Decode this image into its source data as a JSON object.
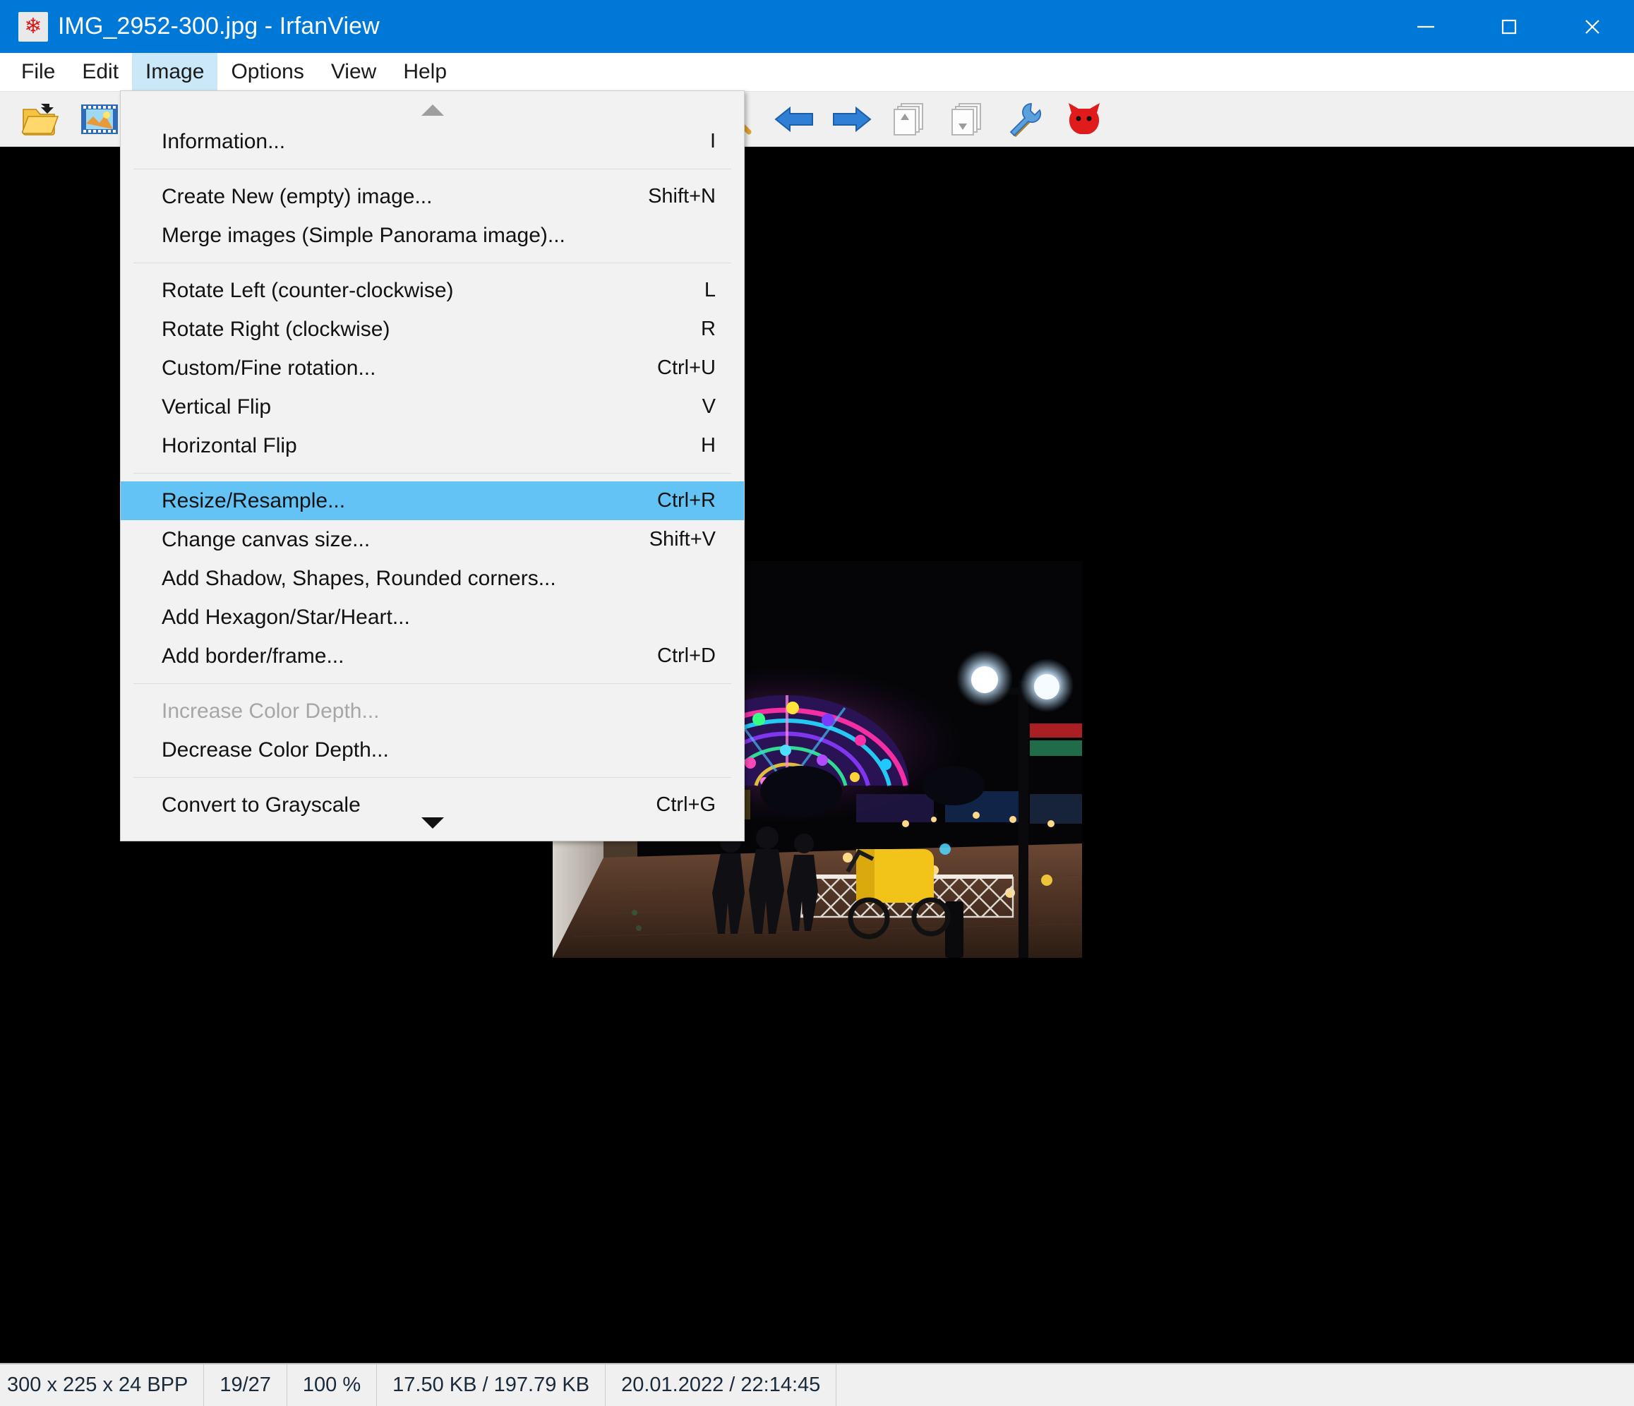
{
  "window": {
    "title": "IMG_2952-300.jpg - IrfanView",
    "icon": "irfanview-cat-icon",
    "controls": [
      {
        "name": "minimize-button",
        "glyph": "minimize"
      },
      {
        "name": "maximize-button",
        "glyph": "maximize"
      },
      {
        "name": "close-button",
        "glyph": "close"
      }
    ]
  },
  "menubar": {
    "items": [
      {
        "label": "File",
        "name": "menubar-item-file",
        "active": false
      },
      {
        "label": "Edit",
        "name": "menubar-item-edit",
        "active": false
      },
      {
        "label": "Image",
        "name": "menubar-item-image",
        "active": true
      },
      {
        "label": "Options",
        "name": "menubar-item-options",
        "active": false
      },
      {
        "label": "View",
        "name": "menubar-item-view",
        "active": false
      },
      {
        "label": "Help",
        "name": "menubar-item-help",
        "active": false
      }
    ]
  },
  "toolbar": {
    "buttons": [
      {
        "name": "open-file-icon",
        "icon": "open-folder-icon",
        "enabled": true
      },
      {
        "name": "thumbnails-icon",
        "icon": "filmstrip-thumbnail-icon",
        "enabled": true
      },
      {
        "name": "zoom-out-icon",
        "icon": "magnifier-minus-icon",
        "enabled": true
      },
      {
        "name": "previous-image-icon",
        "icon": "arrow-left-icon",
        "enabled": true
      },
      {
        "name": "next-image-icon",
        "icon": "arrow-right-icon",
        "enabled": true
      },
      {
        "name": "previous-page-icon",
        "icon": "pages-up-icon",
        "enabled": false
      },
      {
        "name": "next-page-icon",
        "icon": "pages-down-icon",
        "enabled": false
      },
      {
        "name": "settings-icon",
        "icon": "tools-wrench-icon",
        "enabled": true
      },
      {
        "name": "irfanview-logo-icon",
        "icon": "red-cat-icon",
        "enabled": true
      }
    ]
  },
  "image_menu": {
    "scroll_up": "scroll-up-arrow",
    "scroll_down": "scroll-down-arrow",
    "groups": [
      {
        "items": [
          {
            "label": "Information...",
            "shortcut": "I",
            "state": "normal",
            "name": "menu-item-information"
          }
        ]
      },
      {
        "items": [
          {
            "label": "Create New (empty) image...",
            "shortcut": "Shift+N",
            "state": "normal",
            "name": "menu-item-create-new-image"
          },
          {
            "label": "Merge images (Simple Panorama image)...",
            "shortcut": "",
            "state": "normal",
            "name": "menu-item-merge-images"
          }
        ]
      },
      {
        "items": [
          {
            "label": "Rotate Left (counter-clockwise)",
            "shortcut": "L",
            "state": "normal",
            "name": "menu-item-rotate-left"
          },
          {
            "label": "Rotate Right (clockwise)",
            "shortcut": "R",
            "state": "normal",
            "name": "menu-item-rotate-right"
          },
          {
            "label": "Custom/Fine rotation...",
            "shortcut": "Ctrl+U",
            "state": "normal",
            "name": "menu-item-custom-fine-rotation"
          },
          {
            "label": "Vertical Flip",
            "shortcut": "V",
            "state": "normal",
            "name": "menu-item-vertical-flip"
          },
          {
            "label": "Horizontal Flip",
            "shortcut": "H",
            "state": "normal",
            "name": "menu-item-horizontal-flip"
          }
        ]
      },
      {
        "items": [
          {
            "label": "Resize/Resample...",
            "shortcut": "Ctrl+R",
            "state": "selected",
            "name": "menu-item-resize-resample"
          },
          {
            "label": "Change canvas size...",
            "shortcut": "Shift+V",
            "state": "normal",
            "name": "menu-item-change-canvas-size"
          },
          {
            "label": "Add Shadow, Shapes, Rounded corners...",
            "shortcut": "",
            "state": "normal",
            "name": "menu-item-add-shadow-shapes"
          },
          {
            "label": "Add Hexagon/Star/Heart...",
            "shortcut": "",
            "state": "normal",
            "name": "menu-item-add-hexagon-star-heart"
          },
          {
            "label": "Add border/frame...",
            "shortcut": "Ctrl+D",
            "state": "normal",
            "name": "menu-item-add-border-frame"
          }
        ]
      },
      {
        "items": [
          {
            "label": "Increase Color Depth...",
            "shortcut": "",
            "state": "disabled",
            "name": "menu-item-increase-color-depth"
          },
          {
            "label": "Decrease Color Depth...",
            "shortcut": "",
            "state": "normal",
            "name": "menu-item-decrease-color-depth"
          }
        ]
      },
      {
        "items": [
          {
            "label": "Convert to Grayscale",
            "shortcut": "Ctrl+G",
            "state": "normal",
            "name": "menu-item-convert-to-grayscale"
          }
        ]
      }
    ]
  },
  "statusbar": {
    "cells": [
      {
        "text": "300 x 225 x 24 BPP",
        "name": "status-dimensions"
      },
      {
        "text": "19/27",
        "name": "status-index"
      },
      {
        "text": "100 %",
        "name": "status-zoom"
      },
      {
        "text": "17.50 KB / 197.79 KB",
        "name": "status-filesize"
      },
      {
        "text": "20.01.2022 / 22:14:45",
        "name": "status-datetime"
      }
    ]
  },
  "colors": {
    "titlebar": "#0078D7",
    "menu_highlight": "#64C3F5",
    "menubar_active": "#cbe8f8",
    "menu_bg": "#f2f2f2",
    "canvas_bg": "#000000",
    "statusbar_bg": "#f0f0f0"
  },
  "photo": {
    "description": "Night scene: illuminated multicolored LED domes, street lamps, people and yellow pedicab on a promenade with a white lattice fence"
  }
}
